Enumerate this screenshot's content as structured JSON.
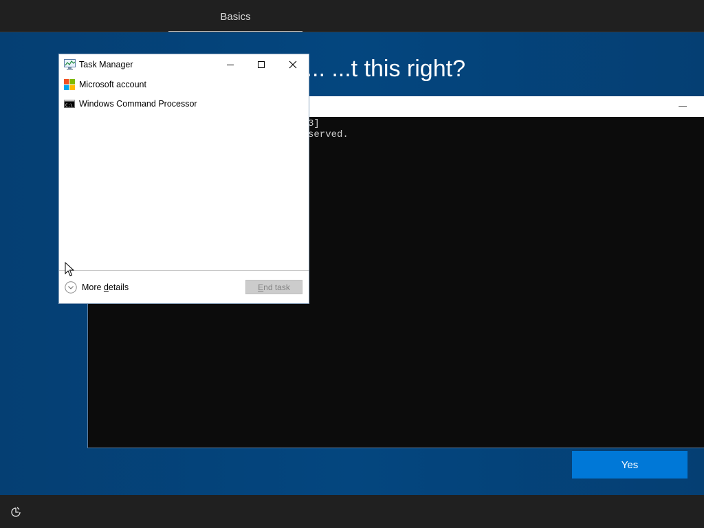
{
  "oobe": {
    "tab_label": "Basics",
    "heading_fragment": "is...  ...t this right?",
    "yes_label": "Yes",
    "accessibility_icon": "accessibility-icon"
  },
  "cmd": {
    "line1": "3]",
    "line2": "served.",
    "minimize_icon": "minimize-icon"
  },
  "task_manager": {
    "title": "Task Manager",
    "rows": [
      {
        "label": "Microsoft account",
        "icon": "microsoft-logo-icon"
      },
      {
        "label": "Windows Command Processor",
        "icon": "cmd-icon"
      }
    ],
    "more_details_pre": "More ",
    "more_details_underlined": "d",
    "more_details_post": "etails",
    "end_task_underlined": "E",
    "end_task_post": "nd task"
  },
  "colors": {
    "oobe_blue": "#003b6f",
    "accent": "#0078d7",
    "bar": "#202020",
    "console_bg": "#0c0c0c"
  }
}
